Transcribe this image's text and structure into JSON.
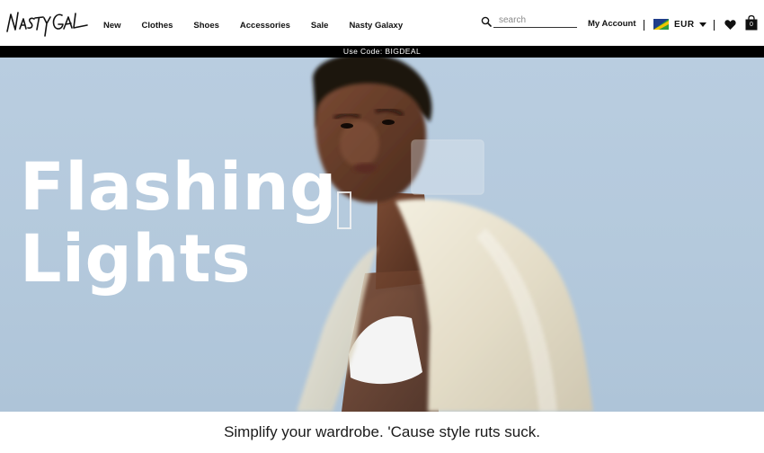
{
  "header": {
    "logo_text": "Nasty Gal",
    "nav": [
      {
        "label": "New"
      },
      {
        "label": "Clothes"
      },
      {
        "label": "Shoes"
      },
      {
        "label": "Accessories"
      },
      {
        "label": "Sale"
      },
      {
        "label": "Nasty Galaxy"
      }
    ],
    "search": {
      "placeholder": "search",
      "value": "",
      "icon": "search-icon"
    },
    "account_label": "My Account",
    "currency": {
      "code": "EUR",
      "icon": "flag-icon"
    },
    "wishlist_icon": "heart-icon",
    "bag": {
      "icon": "shopping-bag-icon",
      "count": "0"
    }
  },
  "promo": {
    "text": "Use Code: BIGDEAL"
  },
  "hero": {
    "title_line1": "Flashing",
    "title_line2": "Lights",
    "background_color": "#b6cadd"
  },
  "tagline": {
    "text": "Simplify your wardrobe. 'Cause style ruts suck."
  },
  "colors": {
    "promo_bg": "#000000",
    "text": "#111111",
    "hero_title": "#ffffff"
  }
}
